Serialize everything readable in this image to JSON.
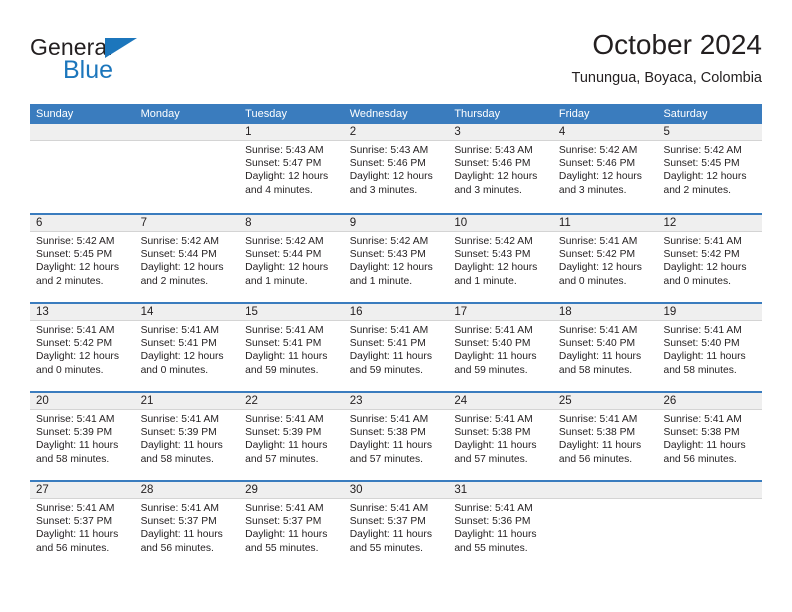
{
  "brand": {
    "name_top": "General",
    "name_bottom": "Blue",
    "accent_color": "#1c76bc"
  },
  "header": {
    "title": "October 2024",
    "subtitle": "Tunungua, Boyaca, Colombia"
  },
  "theme": {
    "header_bg": "#3a7cbe",
    "date_strip_bg": "#efefef",
    "text_color": "#231f20"
  },
  "weekdays": [
    "Sunday",
    "Monday",
    "Tuesday",
    "Wednesday",
    "Thursday",
    "Friday",
    "Saturday"
  ],
  "weeks": [
    [
      {
        "day": "",
        "sunrise": "",
        "sunset": "",
        "daylight": "",
        "empty": true
      },
      {
        "day": "",
        "sunrise": "",
        "sunset": "",
        "daylight": "",
        "empty": true
      },
      {
        "day": "1",
        "sunrise": "Sunrise: 5:43 AM",
        "sunset": "Sunset: 5:47 PM",
        "daylight": "Daylight: 12 hours and 4 minutes."
      },
      {
        "day": "2",
        "sunrise": "Sunrise: 5:43 AM",
        "sunset": "Sunset: 5:46 PM",
        "daylight": "Daylight: 12 hours and 3 minutes."
      },
      {
        "day": "3",
        "sunrise": "Sunrise: 5:43 AM",
        "sunset": "Sunset: 5:46 PM",
        "daylight": "Daylight: 12 hours and 3 minutes."
      },
      {
        "day": "4",
        "sunrise": "Sunrise: 5:42 AM",
        "sunset": "Sunset: 5:46 PM",
        "daylight": "Daylight: 12 hours and 3 minutes."
      },
      {
        "day": "5",
        "sunrise": "Sunrise: 5:42 AM",
        "sunset": "Sunset: 5:45 PM",
        "daylight": "Daylight: 12 hours and 2 minutes."
      }
    ],
    [
      {
        "day": "6",
        "sunrise": "Sunrise: 5:42 AM",
        "sunset": "Sunset: 5:45 PM",
        "daylight": "Daylight: 12 hours and 2 minutes."
      },
      {
        "day": "7",
        "sunrise": "Sunrise: 5:42 AM",
        "sunset": "Sunset: 5:44 PM",
        "daylight": "Daylight: 12 hours and 2 minutes."
      },
      {
        "day": "8",
        "sunrise": "Sunrise: 5:42 AM",
        "sunset": "Sunset: 5:44 PM",
        "daylight": "Daylight: 12 hours and 1 minute."
      },
      {
        "day": "9",
        "sunrise": "Sunrise: 5:42 AM",
        "sunset": "Sunset: 5:43 PM",
        "daylight": "Daylight: 12 hours and 1 minute."
      },
      {
        "day": "10",
        "sunrise": "Sunrise: 5:42 AM",
        "sunset": "Sunset: 5:43 PM",
        "daylight": "Daylight: 12 hours and 1 minute."
      },
      {
        "day": "11",
        "sunrise": "Sunrise: 5:41 AM",
        "sunset": "Sunset: 5:42 PM",
        "daylight": "Daylight: 12 hours and 0 minutes."
      },
      {
        "day": "12",
        "sunrise": "Sunrise: 5:41 AM",
        "sunset": "Sunset: 5:42 PM",
        "daylight": "Daylight: 12 hours and 0 minutes."
      }
    ],
    [
      {
        "day": "13",
        "sunrise": "Sunrise: 5:41 AM",
        "sunset": "Sunset: 5:42 PM",
        "daylight": "Daylight: 12 hours and 0 minutes."
      },
      {
        "day": "14",
        "sunrise": "Sunrise: 5:41 AM",
        "sunset": "Sunset: 5:41 PM",
        "daylight": "Daylight: 12 hours and 0 minutes."
      },
      {
        "day": "15",
        "sunrise": "Sunrise: 5:41 AM",
        "sunset": "Sunset: 5:41 PM",
        "daylight": "Daylight: 11 hours and 59 minutes."
      },
      {
        "day": "16",
        "sunrise": "Sunrise: 5:41 AM",
        "sunset": "Sunset: 5:41 PM",
        "daylight": "Daylight: 11 hours and 59 minutes."
      },
      {
        "day": "17",
        "sunrise": "Sunrise: 5:41 AM",
        "sunset": "Sunset: 5:40 PM",
        "daylight": "Daylight: 11 hours and 59 minutes."
      },
      {
        "day": "18",
        "sunrise": "Sunrise: 5:41 AM",
        "sunset": "Sunset: 5:40 PM",
        "daylight": "Daylight: 11 hours and 58 minutes."
      },
      {
        "day": "19",
        "sunrise": "Sunrise: 5:41 AM",
        "sunset": "Sunset: 5:40 PM",
        "daylight": "Daylight: 11 hours and 58 minutes."
      }
    ],
    [
      {
        "day": "20",
        "sunrise": "Sunrise: 5:41 AM",
        "sunset": "Sunset: 5:39 PM",
        "daylight": "Daylight: 11 hours and 58 minutes."
      },
      {
        "day": "21",
        "sunrise": "Sunrise: 5:41 AM",
        "sunset": "Sunset: 5:39 PM",
        "daylight": "Daylight: 11 hours and 58 minutes."
      },
      {
        "day": "22",
        "sunrise": "Sunrise: 5:41 AM",
        "sunset": "Sunset: 5:39 PM",
        "daylight": "Daylight: 11 hours and 57 minutes."
      },
      {
        "day": "23",
        "sunrise": "Sunrise: 5:41 AM",
        "sunset": "Sunset: 5:38 PM",
        "daylight": "Daylight: 11 hours and 57 minutes."
      },
      {
        "day": "24",
        "sunrise": "Sunrise: 5:41 AM",
        "sunset": "Sunset: 5:38 PM",
        "daylight": "Daylight: 11 hours and 57 minutes."
      },
      {
        "day": "25",
        "sunrise": "Sunrise: 5:41 AM",
        "sunset": "Sunset: 5:38 PM",
        "daylight": "Daylight: 11 hours and 56 minutes."
      },
      {
        "day": "26",
        "sunrise": "Sunrise: 5:41 AM",
        "sunset": "Sunset: 5:38 PM",
        "daylight": "Daylight: 11 hours and 56 minutes."
      }
    ],
    [
      {
        "day": "27",
        "sunrise": "Sunrise: 5:41 AM",
        "sunset": "Sunset: 5:37 PM",
        "daylight": "Daylight: 11 hours and 56 minutes."
      },
      {
        "day": "28",
        "sunrise": "Sunrise: 5:41 AM",
        "sunset": "Sunset: 5:37 PM",
        "daylight": "Daylight: 11 hours and 56 minutes."
      },
      {
        "day": "29",
        "sunrise": "Sunrise: 5:41 AM",
        "sunset": "Sunset: 5:37 PM",
        "daylight": "Daylight: 11 hours and 55 minutes."
      },
      {
        "day": "30",
        "sunrise": "Sunrise: 5:41 AM",
        "sunset": "Sunset: 5:37 PM",
        "daylight": "Daylight: 11 hours and 55 minutes."
      },
      {
        "day": "31",
        "sunrise": "Sunrise: 5:41 AM",
        "sunset": "Sunset: 5:36 PM",
        "daylight": "Daylight: 11 hours and 55 minutes."
      },
      {
        "day": "",
        "sunrise": "",
        "sunset": "",
        "daylight": "",
        "empty": true
      },
      {
        "day": "",
        "sunrise": "",
        "sunset": "",
        "daylight": "",
        "empty": true
      }
    ]
  ]
}
